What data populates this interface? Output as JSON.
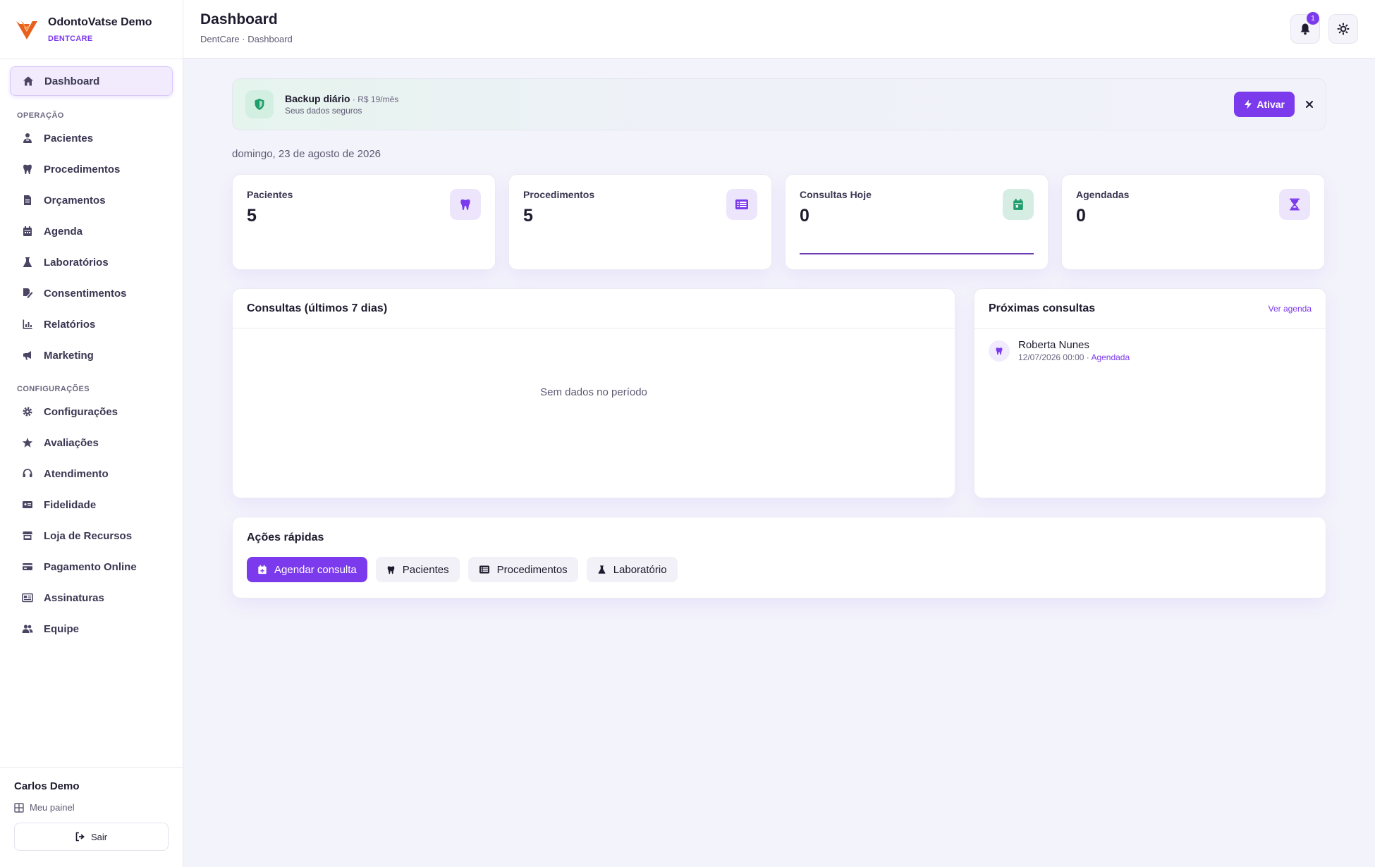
{
  "brand": {
    "name": "OdontoVatse Demo",
    "subtitle": "DENTCARE"
  },
  "sidebar": {
    "dashboard": {
      "label": "Dashboard",
      "icon": "home-icon"
    },
    "sections": [
      {
        "title": "OPERAÇÃO",
        "items": [
          {
            "label": "Pacientes",
            "icon": "patient-icon"
          },
          {
            "label": "Procedimentos",
            "icon": "tooth-icon"
          },
          {
            "label": "Orçamentos",
            "icon": "invoice-icon"
          },
          {
            "label": "Agenda",
            "icon": "calendar-icon"
          },
          {
            "label": "Laboratórios",
            "icon": "flask-icon"
          },
          {
            "label": "Consentimentos",
            "icon": "signature-icon"
          },
          {
            "label": "Relatórios",
            "icon": "chart-icon"
          },
          {
            "label": "Marketing",
            "icon": "megaphone-icon"
          }
        ]
      },
      {
        "title": "CONFIGURAÇÕES",
        "items": [
          {
            "label": "Configurações",
            "icon": "gear-icon"
          },
          {
            "label": "Avaliações",
            "icon": "star-icon"
          },
          {
            "label": "Atendimento",
            "icon": "headset-icon"
          },
          {
            "label": "Fidelidade",
            "icon": "card-icon"
          },
          {
            "label": "Loja de Recursos",
            "icon": "store-icon"
          },
          {
            "label": "Pagamento Online",
            "icon": "credit-card-icon"
          },
          {
            "label": "Assinaturas",
            "icon": "subscription-icon"
          },
          {
            "label": "Equipe",
            "icon": "users-icon"
          }
        ]
      }
    ],
    "footer": {
      "user_name": "Carlos Demo",
      "my_panel": "Meu painel",
      "logout": "Sair"
    }
  },
  "header": {
    "title": "Dashboard",
    "breadcrumb": "DentCare · Dashboard",
    "notification_count": "1"
  },
  "banner": {
    "title": "Backup diário",
    "price": " · R$ 19/mês",
    "subtitle": "Seus dados seguros",
    "activate": "Ativar"
  },
  "date_text": "domingo, 23 de agosto de 2026",
  "stats": [
    {
      "label": "Pacientes",
      "value": "5",
      "icon": "tooth-icon"
    },
    {
      "label": "Procedimentos",
      "value": "5",
      "icon": "list-icon"
    },
    {
      "label": "Consultas Hoje",
      "value": "0",
      "icon": "calendar-check-icon"
    },
    {
      "label": "Agendadas",
      "value": "0",
      "icon": "hourglass-icon"
    }
  ],
  "chart_card": {
    "title": "Consultas (últimos 7 dias)",
    "empty": "Sem dados no período"
  },
  "next_appointments": {
    "title": "Próximas consultas",
    "see_all": "Ver agenda",
    "items": [
      {
        "name": "Roberta Nunes",
        "datetime": "12/07/2026 00:00",
        "status": "Agendada"
      }
    ]
  },
  "quick_actions": {
    "title": "Ações rápidas",
    "buttons": [
      {
        "label": "Agendar consulta",
        "icon": "calendar-plus-icon"
      },
      {
        "label": "Pacientes",
        "icon": "tooth-icon"
      },
      {
        "label": "Procedimentos",
        "icon": "list-icon"
      },
      {
        "label": "Laboratório",
        "icon": "flask-icon"
      }
    ]
  },
  "colors": {
    "accent": "#7c3aed",
    "success": "#1f9d6a",
    "brand_logo": "#e8601c"
  }
}
